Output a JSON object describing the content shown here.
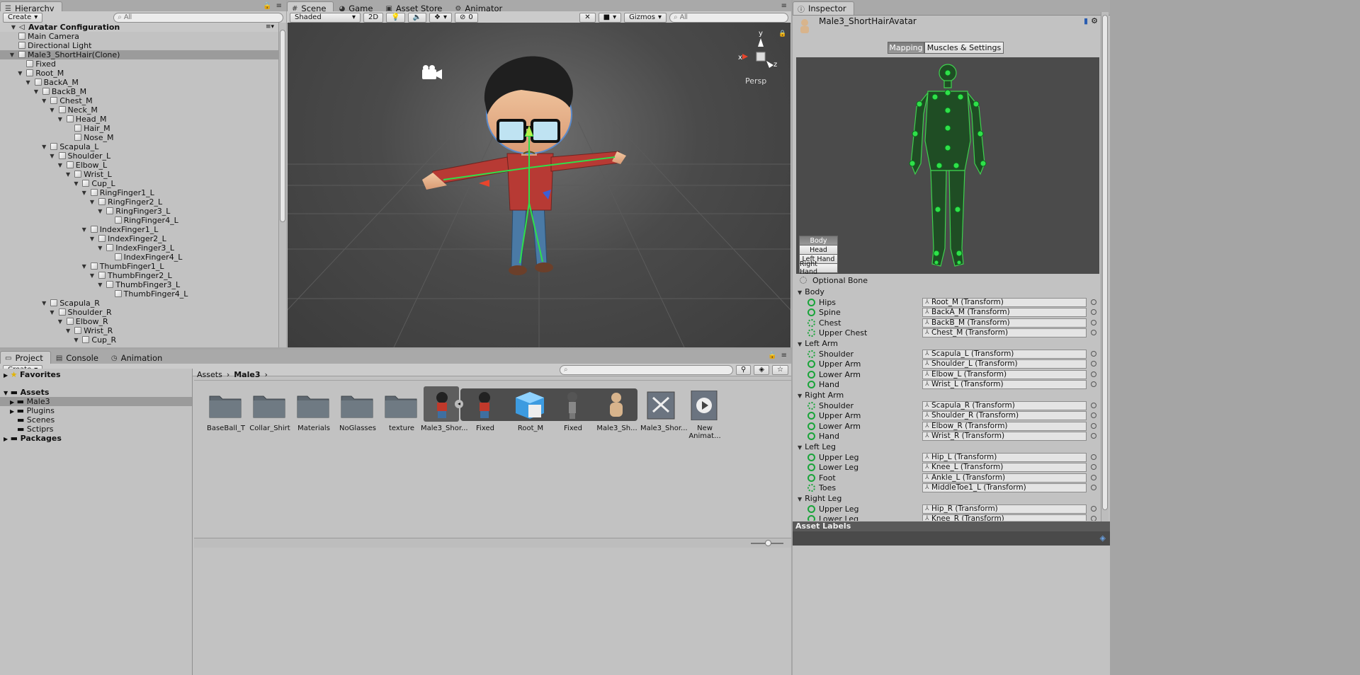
{
  "hierarchy": {
    "tab": "Hierarchy",
    "create": "Create",
    "search_placeholder": "All",
    "scene_name": "Avatar Configuration",
    "items": [
      {
        "label": "Main Camera"
      },
      {
        "label": "Directional Light"
      },
      {
        "label": "Male3_ShortHair(Clone)"
      },
      {
        "label": "Fixed"
      },
      {
        "label": "Root_M"
      },
      {
        "label": "BackA_M"
      },
      {
        "label": "BackB_M"
      },
      {
        "label": "Chest_M"
      },
      {
        "label": "Neck_M"
      },
      {
        "label": "Head_M"
      },
      {
        "label": "Hair_M"
      },
      {
        "label": "Nose_M"
      },
      {
        "label": "Scapula_L"
      },
      {
        "label": "Shoulder_L"
      },
      {
        "label": "Elbow_L"
      },
      {
        "label": "Wrist_L"
      },
      {
        "label": "Cup_L"
      },
      {
        "label": "RingFinger1_L"
      },
      {
        "label": "RingFinger2_L"
      },
      {
        "label": "RingFinger3_L"
      },
      {
        "label": "RingFinger4_L"
      },
      {
        "label": "IndexFinger1_L"
      },
      {
        "label": "IndexFinger2_L"
      },
      {
        "label": "IndexFinger3_L"
      },
      {
        "label": "IndexFinger4_L"
      },
      {
        "label": "ThumbFinger1_L"
      },
      {
        "label": "ThumbFinger2_L"
      },
      {
        "label": "ThumbFinger3_L"
      },
      {
        "label": "ThumbFinger4_L"
      },
      {
        "label": "Scapula_R"
      },
      {
        "label": "Shoulder_R"
      },
      {
        "label": "Elbow_R"
      },
      {
        "label": "Wrist_R"
      },
      {
        "label": "Cup_R"
      }
    ]
  },
  "scene": {
    "tabs": [
      {
        "label": "Scene",
        "icon": "grid-icon"
      },
      {
        "label": "Game",
        "icon": "pacman-icon"
      },
      {
        "label": "Asset Store",
        "icon": "store-icon"
      },
      {
        "label": "Animator",
        "icon": "animator-icon"
      }
    ],
    "shading": "Shaded",
    "mode_2d": "2D",
    "fx_count": "0",
    "gizmos": "Gizmos",
    "search_placeholder": "All",
    "persp_label": "Persp",
    "axis_x": "x",
    "axis_y": "y",
    "axis_z": "z"
  },
  "project": {
    "tabs": [
      {
        "label": "Project",
        "icon": "folder-icon"
      },
      {
        "label": "Console",
        "icon": "console-icon"
      },
      {
        "label": "Animation",
        "icon": "clock-icon"
      }
    ],
    "create": "Create",
    "tree": {
      "favorites": "Favorites",
      "assets": "Assets",
      "children": [
        "Male3",
        "Plugins",
        "Scenes",
        "Sctiprs"
      ],
      "packages": "Packages"
    },
    "breadcrumb": [
      "Assets",
      "Male3"
    ],
    "assets": [
      {
        "label": "BaseBall_T",
        "kind": "folder"
      },
      {
        "label": "Collar_Shirt",
        "kind": "folder"
      },
      {
        "label": "Materials",
        "kind": "folder"
      },
      {
        "label": "NoGlasses",
        "kind": "folder"
      },
      {
        "label": "texture",
        "kind": "folder"
      },
      {
        "label": "Male3_Shor...",
        "kind": "model"
      },
      {
        "label": "Fixed",
        "kind": "mesh"
      },
      {
        "label": "Root_M",
        "kind": "cube"
      },
      {
        "label": "Fixed",
        "kind": "mesh-gray"
      },
      {
        "label": "Male3_Sh...",
        "kind": "avatar"
      },
      {
        "label": "Male3_Shor...",
        "kind": "prefab"
      },
      {
        "label": "New Animat...",
        "kind": "anim"
      }
    ]
  },
  "inspector": {
    "tab": "Inspector",
    "object_name": "Male3_ShortHairAvatar",
    "tab_mapping": "Mapping",
    "tab_muscles": "Muscles & Settings",
    "body_buttons": [
      "Body",
      "Head",
      "Left Hand",
      "Right Hand"
    ],
    "optional_bone": "Optional Bone",
    "groups": [
      {
        "name": "Body",
        "bones": [
          {
            "label": "Hips",
            "value": "Root_M (Transform)",
            "required": true
          },
          {
            "label": "Spine",
            "value": "BackA_M (Transform)",
            "required": true
          },
          {
            "label": "Chest",
            "value": "BackB_M (Transform)",
            "required": false
          },
          {
            "label": "Upper Chest",
            "value": "Chest_M (Transform)",
            "required": false
          }
        ]
      },
      {
        "name": "Left Arm",
        "bones": [
          {
            "label": "Shoulder",
            "value": "Scapula_L (Transform)",
            "required": false
          },
          {
            "label": "Upper Arm",
            "value": "Shoulder_L (Transform)",
            "required": true
          },
          {
            "label": "Lower Arm",
            "value": "Elbow_L (Transform)",
            "required": true
          },
          {
            "label": "Hand",
            "value": "Wrist_L (Transform)",
            "required": true
          }
        ]
      },
      {
        "name": "Right Arm",
        "bones": [
          {
            "label": "Shoulder",
            "value": "Scapula_R (Transform)",
            "required": false
          },
          {
            "label": "Upper Arm",
            "value": "Shoulder_R (Transform)",
            "required": true
          },
          {
            "label": "Lower Arm",
            "value": "Elbow_R (Transform)",
            "required": true
          },
          {
            "label": "Hand",
            "value": "Wrist_R (Transform)",
            "required": true
          }
        ]
      },
      {
        "name": "Left Leg",
        "bones": [
          {
            "label": "Upper Leg",
            "value": "Hip_L (Transform)",
            "required": true
          },
          {
            "label": "Lower Leg",
            "value": "Knee_L (Transform)",
            "required": true
          },
          {
            "label": "Foot",
            "value": "Ankle_L (Transform)",
            "required": true
          },
          {
            "label": "Toes",
            "value": "MiddleToe1_L (Transform)",
            "required": false
          }
        ]
      },
      {
        "name": "Right Leg",
        "bones": [
          {
            "label": "Upper Leg",
            "value": "Hip_R (Transform)",
            "required": true
          },
          {
            "label": "Lower Leg",
            "value": "Knee_R (Transform)",
            "required": true
          }
        ]
      }
    ],
    "asset_labels": "Asset Labels"
  },
  "colors": {
    "bone_green": "#1aa43a",
    "scene_bg": "#4a4a4a",
    "panel": "#c2c2c2"
  }
}
